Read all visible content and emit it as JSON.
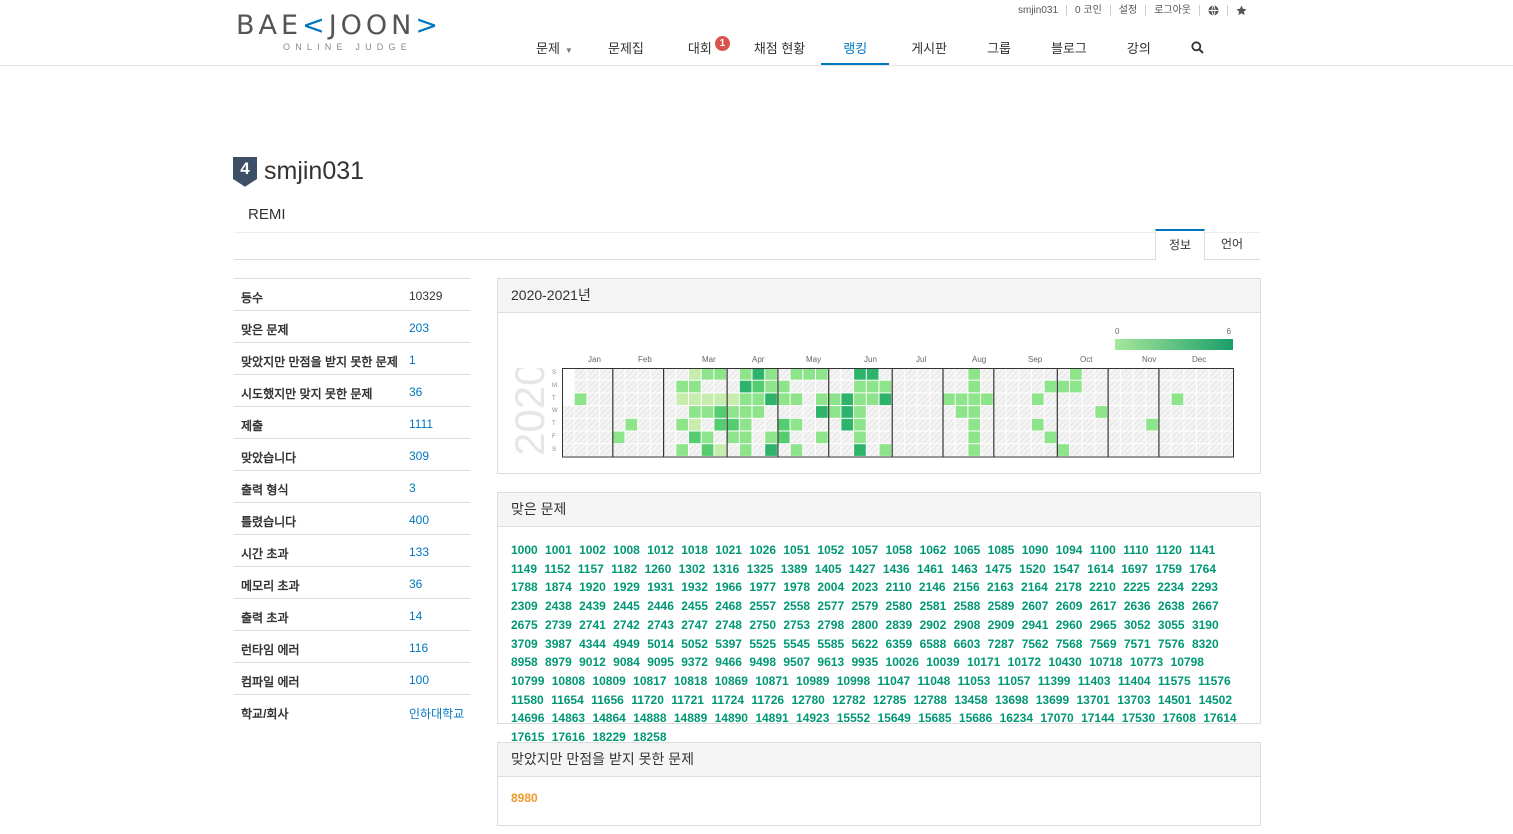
{
  "header": {
    "logo_text_1": "BAE",
    "logo_text_2": "K",
    "logo_text_3": "JOON",
    "logo_text_4": ">",
    "logo_sub": "ONLINE JUDGE",
    "top_links": [
      "smjin031",
      "0 코인",
      "설정",
      "로그아웃"
    ],
    "nav": [
      {
        "label": "문제",
        "dropdown": true
      },
      {
        "label": "문제집"
      },
      {
        "label": "대회",
        "badge": "1"
      },
      {
        "label": "채점 현황"
      },
      {
        "label": "랭킹",
        "active": true
      },
      {
        "label": "게시판"
      },
      {
        "label": "그룹"
      },
      {
        "label": "블로그"
      },
      {
        "label": "강의"
      }
    ]
  },
  "profile": {
    "tier": "4",
    "username": "smjin031",
    "status_message": "REMI",
    "tabs": [
      "정보",
      "언어"
    ]
  },
  "stats": [
    {
      "label": "등수",
      "value": "10329",
      "link": false
    },
    {
      "label": "맞은 문제",
      "value": "203",
      "link": true
    },
    {
      "label": "맞았지만 만점을 받지 못한 문제",
      "value": "1",
      "link": true
    },
    {
      "label": "시도했지만 맞지 못한 문제",
      "value": "36",
      "link": true
    },
    {
      "label": "제출",
      "value": "1111",
      "link": true
    },
    {
      "label": "맞았습니다",
      "value": "309",
      "link": true
    },
    {
      "label": "출력 형식",
      "value": "3",
      "link": true
    },
    {
      "label": "틀렸습니다",
      "value": "400",
      "link": true
    },
    {
      "label": "시간 초과",
      "value": "133",
      "link": true
    },
    {
      "label": "메모리 초과",
      "value": "36",
      "link": true
    },
    {
      "label": "출력 초과",
      "value": "14",
      "link": true
    },
    {
      "label": "런타임 에러",
      "value": "116",
      "link": true
    },
    {
      "label": "컴파일 에러",
      "value": "100",
      "link": true
    },
    {
      "label": "학교/회사",
      "value": "인하대학교",
      "link": true
    }
  ],
  "heatmap": {
    "title": "2020-2021년",
    "year": "2020",
    "months": [
      "Jan",
      "Feb",
      "Mar",
      "Apr",
      "May",
      "Jun",
      "Jul",
      "Aug",
      "Sep",
      "Oct",
      "Nov",
      "Dec"
    ],
    "days": [
      "S",
      "M",
      "T",
      "W",
      "T",
      "F",
      "S"
    ],
    "legend_min": "0",
    "legend_max": "6",
    "colors": [
      "#c6ecae",
      "#8ee48a",
      "#55cc70",
      "#2db36a",
      "#148f5e"
    ]
  },
  "solved": {
    "title": "맞은 문제",
    "problems": [
      "1000",
      "1001",
      "1002",
      "1008",
      "1012",
      "1018",
      "1021",
      "1026",
      "1051",
      "1052",
      "1057",
      "1058",
      "1062",
      "1065",
      "1085",
      "1090",
      "1094",
      "1100",
      "1110",
      "1120",
      "1141",
      "1149",
      "1152",
      "1157",
      "1182",
      "1260",
      "1302",
      "1316",
      "1325",
      "1389",
      "1405",
      "1427",
      "1436",
      "1461",
      "1463",
      "1475",
      "1520",
      "1547",
      "1614",
      "1697",
      "1759",
      "1764",
      "1788",
      "1874",
      "1920",
      "1929",
      "1931",
      "1932",
      "1966",
      "1977",
      "1978",
      "2004",
      "2023",
      "2110",
      "2146",
      "2156",
      "2163",
      "2164",
      "2178",
      "2210",
      "2225",
      "2234",
      "2293",
      "2309",
      "2438",
      "2439",
      "2445",
      "2446",
      "2455",
      "2468",
      "2557",
      "2558",
      "2577",
      "2579",
      "2580",
      "2581",
      "2588",
      "2589",
      "2607",
      "2609",
      "2617",
      "2636",
      "2638",
      "2667",
      "2675",
      "2739",
      "2741",
      "2742",
      "2743",
      "2747",
      "2748",
      "2750",
      "2753",
      "2798",
      "2800",
      "2839",
      "2902",
      "2908",
      "2909",
      "2941",
      "2960",
      "2965",
      "3052",
      "3055",
      "3190",
      "3709",
      "3987",
      "4344",
      "4949",
      "5014",
      "5052",
      "5397",
      "5525",
      "5545",
      "5585",
      "5622",
      "6359",
      "6588",
      "6603",
      "7287",
      "7562",
      "7568",
      "7569",
      "7571",
      "7576",
      "8320",
      "8958",
      "8979",
      "9012",
      "9084",
      "9095",
      "9372",
      "9466",
      "9498",
      "9507",
      "9613",
      "9935",
      "10026",
      "10039",
      "10171",
      "10172",
      "10430",
      "10718",
      "10773",
      "10798",
      "10799",
      "10808",
      "10809",
      "10817",
      "10818",
      "10869",
      "10871",
      "10989",
      "10998",
      "11047",
      "11048",
      "11053",
      "11057",
      "11399",
      "11403",
      "11404",
      "11575",
      "11576",
      "11580",
      "11654",
      "11656",
      "11720",
      "11721",
      "11724",
      "11726",
      "12780",
      "12782",
      "12785",
      "12788",
      "13458",
      "13698",
      "13699",
      "13701",
      "13703",
      "14501",
      "14502",
      "14696",
      "14863",
      "14864",
      "14888",
      "14889",
      "14890",
      "14891",
      "14923",
      "15552",
      "15649",
      "15685",
      "15686",
      "16234",
      "17070",
      "17144",
      "17530",
      "17608",
      "17614",
      "17615",
      "17616",
      "18229",
      "18258"
    ]
  },
  "partial": {
    "title": "맞았지만 만점을 받지 못한 문제",
    "problems": [
      "8980"
    ]
  }
}
